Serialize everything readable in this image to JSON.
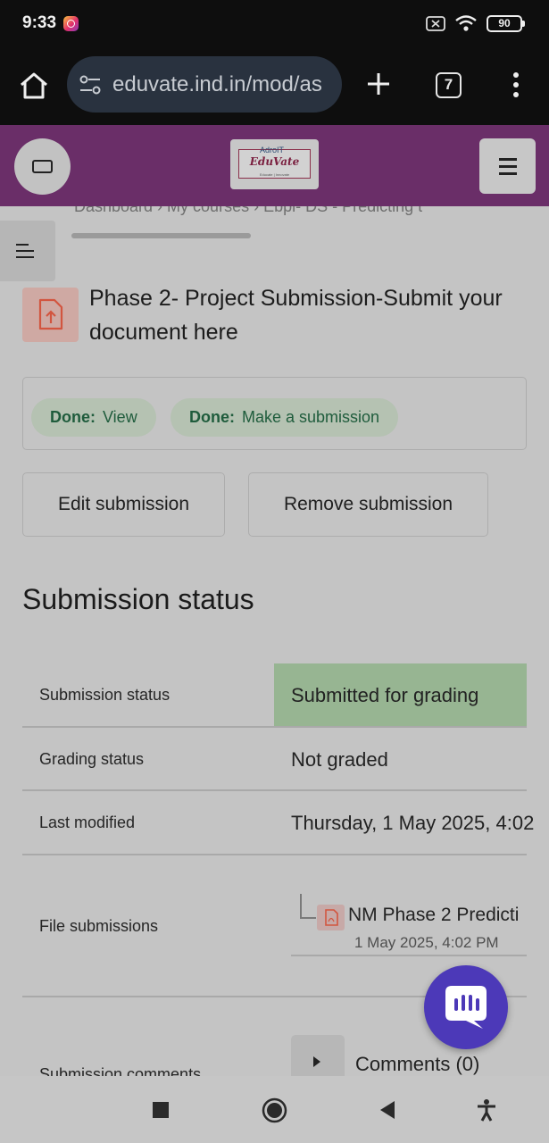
{
  "status_bar": {
    "time": "9:33",
    "battery": "90"
  },
  "browser": {
    "url": "eduvate.ind.in/mod/as",
    "tab_count": "7"
  },
  "site": {
    "logo_top": "AdroIT",
    "logo_main": "EduVate",
    "logo_sub": "Educate | Innovate"
  },
  "breadcrumb": "Dashboard  ›  My courses  ›  Ebpl- DS - Predicting t",
  "activity": {
    "title": "Phase 2- Project Submission-Submit your document here"
  },
  "completion": [
    {
      "done": "Done:",
      "label": "View"
    },
    {
      "done": "Done:",
      "label": "Make a submission"
    }
  ],
  "buttons": {
    "edit": "Edit submission",
    "remove": "Remove submission"
  },
  "section_title": "Submission status",
  "rows": {
    "submission_status": {
      "label": "Submission status",
      "value": "Submitted for grading"
    },
    "grading_status": {
      "label": "Grading status",
      "value": "Not graded"
    },
    "last_modified": {
      "label": "Last modified",
      "value": "Thursday, 1 May 2025, 4:02"
    },
    "file_submissions": {
      "label": "File submissions",
      "file_name": "NM Phase 2 Predicti",
      "file_date": "1 May 2025, 4:02 PM"
    },
    "submission_comments": {
      "label": "Submission comments",
      "value": "Comments (0)"
    }
  },
  "colors": {
    "header": "#6a2e68",
    "status_green": "#97b592",
    "fab": "#4c39b8"
  }
}
